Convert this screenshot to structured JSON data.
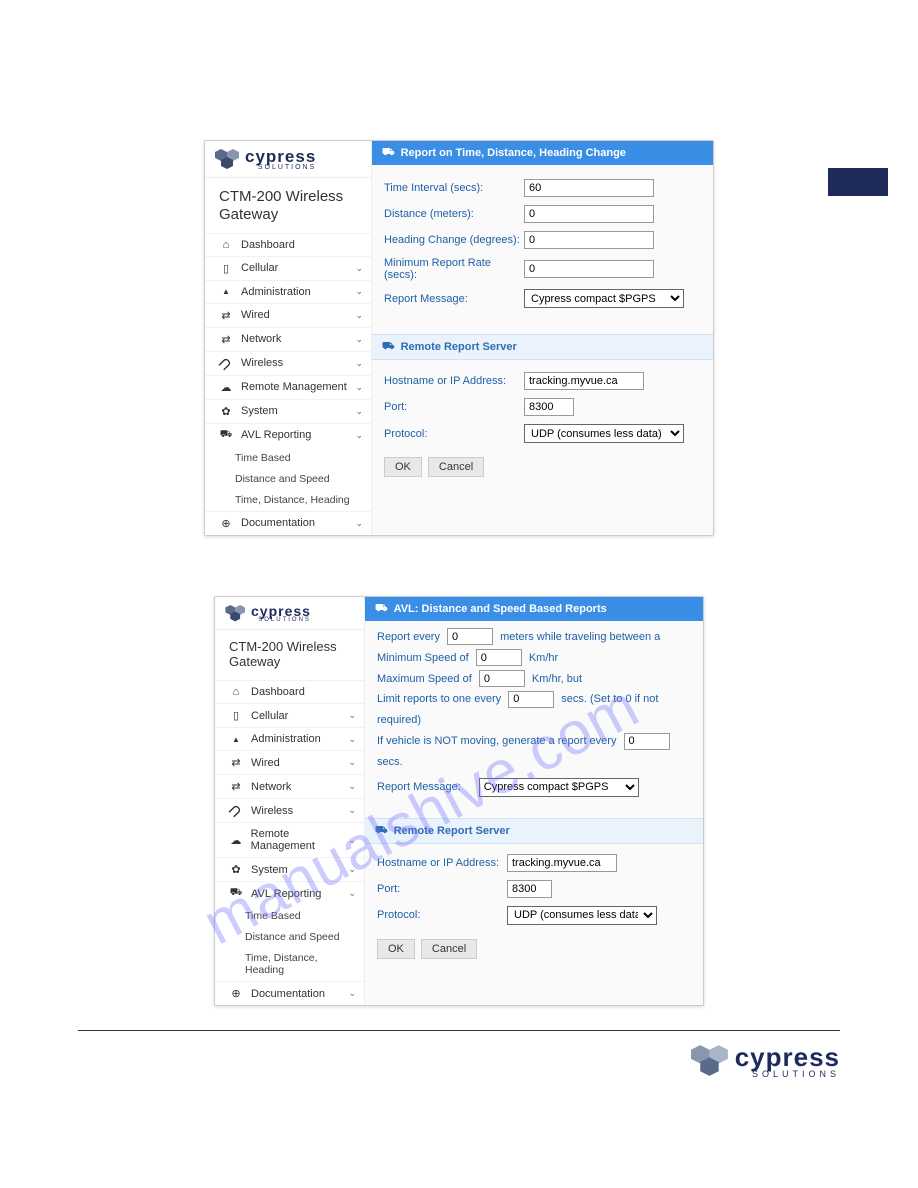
{
  "watermark": "manualshive.com",
  "brand": {
    "name": "cypress",
    "tagline": "SOLUTIONS"
  },
  "product_title": "CTM-200 Wireless Gateway",
  "sidebar": {
    "items": [
      {
        "label": "Dashboard",
        "icon": "home-icon",
        "expandable": false
      },
      {
        "label": "Cellular",
        "icon": "cellular-icon",
        "expandable": true
      },
      {
        "label": "Administration",
        "icon": "user-icon",
        "expandable": true
      },
      {
        "label": "Wired",
        "icon": "arrows-icon",
        "expandable": true
      },
      {
        "label": "Network",
        "icon": "arrows-icon",
        "expandable": true
      },
      {
        "label": "Wireless",
        "icon": "rss-icon",
        "expandable": true
      },
      {
        "label": "Remote Management",
        "icon": "cloud-icon",
        "expandable": true
      },
      {
        "label": "System",
        "icon": "gear-icon",
        "expandable": true
      },
      {
        "label": "AVL Reporting",
        "icon": "truck-icon",
        "expandable": true
      }
    ],
    "avl_sub": [
      "Time Based",
      "Distance and Speed",
      "Time, Distance, Heading"
    ],
    "doc": {
      "label": "Documentation",
      "icon": "globe-icon"
    }
  },
  "panel1": {
    "title": "Report on Time, Distance, Heading Change",
    "rows": {
      "time_interval_label": "Time Interval (secs):",
      "time_interval_value": "60",
      "distance_label": "Distance (meters):",
      "distance_value": "0",
      "heading_label": "Heading Change (degrees):",
      "heading_value": "0",
      "minrate_label": "Minimum Report Rate (secs):",
      "minrate_value": "0",
      "msg_label": "Report Message:",
      "msg_value": "Cypress compact $PGPS"
    },
    "server": {
      "title": "Remote Report Server",
      "host_label": "Hostname or IP Address:",
      "host_value": "tracking.myvue.ca",
      "port_label": "Port:",
      "port_value": "8300",
      "proto_label": "Protocol:",
      "proto_value": "UDP (consumes less data)"
    },
    "ok": "OK",
    "cancel": "Cancel"
  },
  "panel2": {
    "title": "AVL: Distance and Speed Based Reports",
    "t_report_every": "Report every",
    "v_report_every": "0",
    "t_meters_between": "meters while traveling between a",
    "t_minspeed": "Minimum Speed of",
    "v_minspeed": "0",
    "t_kmhr": "Km/hr",
    "t_maxspeed": "Maximum Speed of",
    "v_maxspeed": "0",
    "t_kmhr_but": "Km/hr, but",
    "t_limit": "Limit reports to one every",
    "v_limit": "0",
    "t_limit_tail": "secs. (Set to 0 if not required)",
    "t_notmoving": "If vehicle is NOT moving, generate a report every",
    "v_notmoving": "0",
    "t_secs": "secs.",
    "t_msg": "Report Message:",
    "v_msg": "Cypress compact $PGPS",
    "server": {
      "title": "Remote Report Server",
      "host_label": "Hostname or IP Address:",
      "host_value": "tracking.myvue.ca",
      "port_label": "Port:",
      "port_value": "8300",
      "proto_label": "Protocol:",
      "proto_value": "UDP (consumes less data)"
    },
    "ok": "OK",
    "cancel": "Cancel"
  }
}
